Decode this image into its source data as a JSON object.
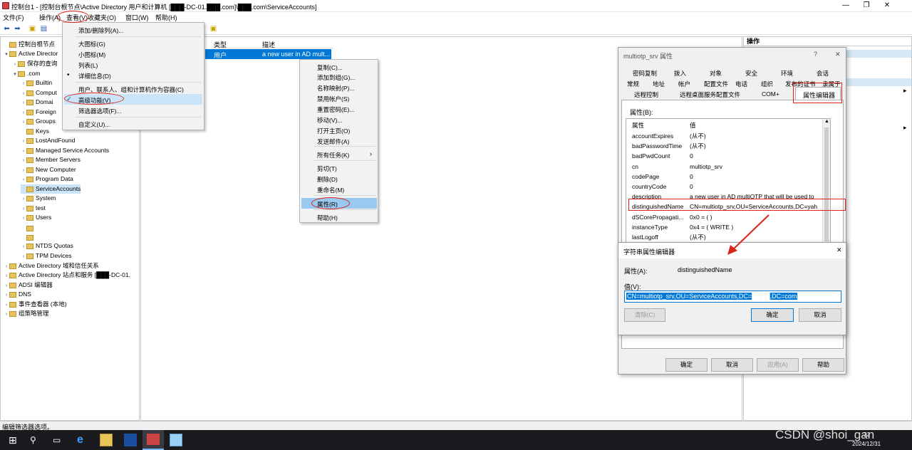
{
  "window": {
    "title": "控制台1 - [控制台根节点\\Active Directory 用户和计算机 [███-DC-01.███.com]\\███.com\\ServiceAccounts]"
  },
  "menubar": [
    "文件(F)",
    "操作(A)",
    "查看(V)",
    "收藏夹(O)",
    "窗口(W)",
    "帮助(H)"
  ],
  "tree": {
    "items": [
      {
        "label": "控制台根节点",
        "level": 0,
        "toggle": ""
      },
      {
        "label": "Active Director",
        "level": 0,
        "toggle": "v"
      },
      {
        "label": "保存的查询",
        "level": 1,
        "toggle": ">"
      },
      {
        "label": ".com",
        "level": 1,
        "toggle": "v"
      },
      {
        "label": "Builtin",
        "level": 2,
        "toggle": ">"
      },
      {
        "label": "Comput",
        "level": 2,
        "toggle": ">"
      },
      {
        "label": "Domai",
        "level": 2,
        "toggle": ">"
      },
      {
        "label": "Foreign",
        "level": 2,
        "toggle": ">"
      },
      {
        "label": "Groups",
        "level": 2,
        "toggle": ">"
      },
      {
        "label": "Keys",
        "level": 2,
        "toggle": ""
      },
      {
        "label": "LostAndFound",
        "level": 2,
        "toggle": ">"
      },
      {
        "label": "Managed Service Accounts",
        "level": 2,
        "toggle": ">"
      },
      {
        "label": "Member Servers",
        "level": 2,
        "toggle": ">"
      },
      {
        "label": "New Computer",
        "level": 2,
        "toggle": ">"
      },
      {
        "label": "Program Data",
        "level": 2,
        "toggle": ">"
      },
      {
        "label": "ServiceAccounts",
        "level": 2,
        "toggle": "",
        "selected": true
      },
      {
        "label": "System",
        "level": 2,
        "toggle": ">"
      },
      {
        "label": "test",
        "level": 2,
        "toggle": ">"
      },
      {
        "label": "Users",
        "level": 2,
        "toggle": ">"
      },
      {
        "label": "",
        "level": 2,
        "toggle": ""
      },
      {
        "label": "",
        "level": 2,
        "toggle": ""
      },
      {
        "label": "NTDS Quotas",
        "level": 2,
        "toggle": ">"
      },
      {
        "label": "TPM Devices",
        "level": 2,
        "toggle": ">"
      },
      {
        "label": "Active Directory 域和信任关系",
        "level": 0,
        "toggle": ">"
      },
      {
        "label": "Active Directory 站点和服务 [███-DC-01.",
        "level": 0,
        "toggle": ">"
      },
      {
        "label": "ADSI 编辑器",
        "level": 0,
        "toggle": ">"
      },
      {
        "label": "DNS",
        "level": 0,
        "toggle": ">"
      },
      {
        "label": "事件查看器 (本地)",
        "level": 0,
        "toggle": ">"
      },
      {
        "label": "组策略管理",
        "level": 0,
        "toggle": ">"
      }
    ]
  },
  "list": {
    "columns": [
      "类型",
      "描述"
    ],
    "rows": [
      {
        "type": "用户",
        "desc": "a new user in AD mult..."
      }
    ]
  },
  "actions": {
    "title": "操作"
  },
  "view_menu": {
    "items": [
      {
        "label": "添加/删除列(A)...",
        "check": ""
      },
      {
        "label": "大图标(G)",
        "check": ""
      },
      {
        "label": "小图标(M)",
        "check": ""
      },
      {
        "label": "列表(L)",
        "check": ""
      },
      {
        "label": "详细信息(D)",
        "check": "•"
      },
      {
        "label": "用户、联系人、组和计算机作为容器(C)",
        "check": ""
      },
      {
        "label": "高级功能(V)",
        "check": "✓"
      },
      {
        "label": "筛选器选项(F)...",
        "check": ""
      },
      {
        "label": "自定义(U)...",
        "check": ""
      }
    ]
  },
  "context_menu": {
    "items": [
      "复制(C)...",
      "添加到组(G)...",
      "名称映射(P)...",
      "禁用帐户(S)",
      "重置密码(E)...",
      "移动(V)...",
      "打开主页(O)",
      "发送邮件(A)",
      "所有任务(K)",
      "剪切(T)",
      "删除(D)",
      "重命名(M)",
      "属性(R)",
      "帮助(H)"
    ]
  },
  "prop_dialog": {
    "title": "multiotp_srv 属性",
    "help": "?",
    "close": "✕",
    "tabs_row1": [
      "密码复制",
      "拨入",
      "对象",
      "安全",
      "环境",
      "会话"
    ],
    "tabs_row2": [
      "常规",
      "地址",
      "帐户",
      "配置文件",
      "电话",
      "组织",
      "发布的证书",
      "隶属于"
    ],
    "tabs_row3": [
      "远程控制",
      "远程桌面服务配置文件",
      "COM+",
      "属性编辑器"
    ],
    "attrs_label": "属性(B):",
    "attr_header": [
      "属性",
      "值"
    ],
    "attrs": [
      {
        "name": "accountExpires",
        "value": "(从不)"
      },
      {
        "name": "badPasswordTime",
        "value": "(从不)"
      },
      {
        "name": "badPwdCount",
        "value": "0"
      },
      {
        "name": "cn",
        "value": "multiotp_srv"
      },
      {
        "name": "codePage",
        "value": "0"
      },
      {
        "name": "countryCode",
        "value": "0"
      },
      {
        "name": "description",
        "value": "a new user in AD multiOTP that will be used to"
      },
      {
        "name": "distinguishedName",
        "value": "CN=multiotp_srv,OU=ServiceAccounts,DC=yah"
      },
      {
        "name": "dSCorePropagati...",
        "value": "0x0 = ( )"
      },
      {
        "name": "instanceType",
        "value": "0x4 = ( WRITE )"
      },
      {
        "name": "lastLogoff",
        "value": "(从不)"
      }
    ],
    "buttons": [
      "确定",
      "取消",
      "应用(A)",
      "帮助"
    ]
  },
  "string_editor": {
    "title": "字符串属性编辑器",
    "close": "✕",
    "attr_label": "属性(A):",
    "attr_value": "distinguishedName",
    "value_label": "值(V):",
    "value": "CN=multiotp_srv,OU=ServiceAccounts,DC=████,DC=com",
    "buttons": [
      "清除(C)",
      "确定",
      "取消"
    ]
  },
  "status": {
    "text": "编辑筛选器选项。"
  },
  "taskbar": {
    "time": "22",
    "date": "2024/12/31"
  },
  "watermark": "CSDN @shoi_gan",
  "colors": {
    "accent": "#0078d7",
    "annotation": "#d9261c",
    "selection": "#cce4f7",
    "taskbar": "#1b1b1f"
  }
}
